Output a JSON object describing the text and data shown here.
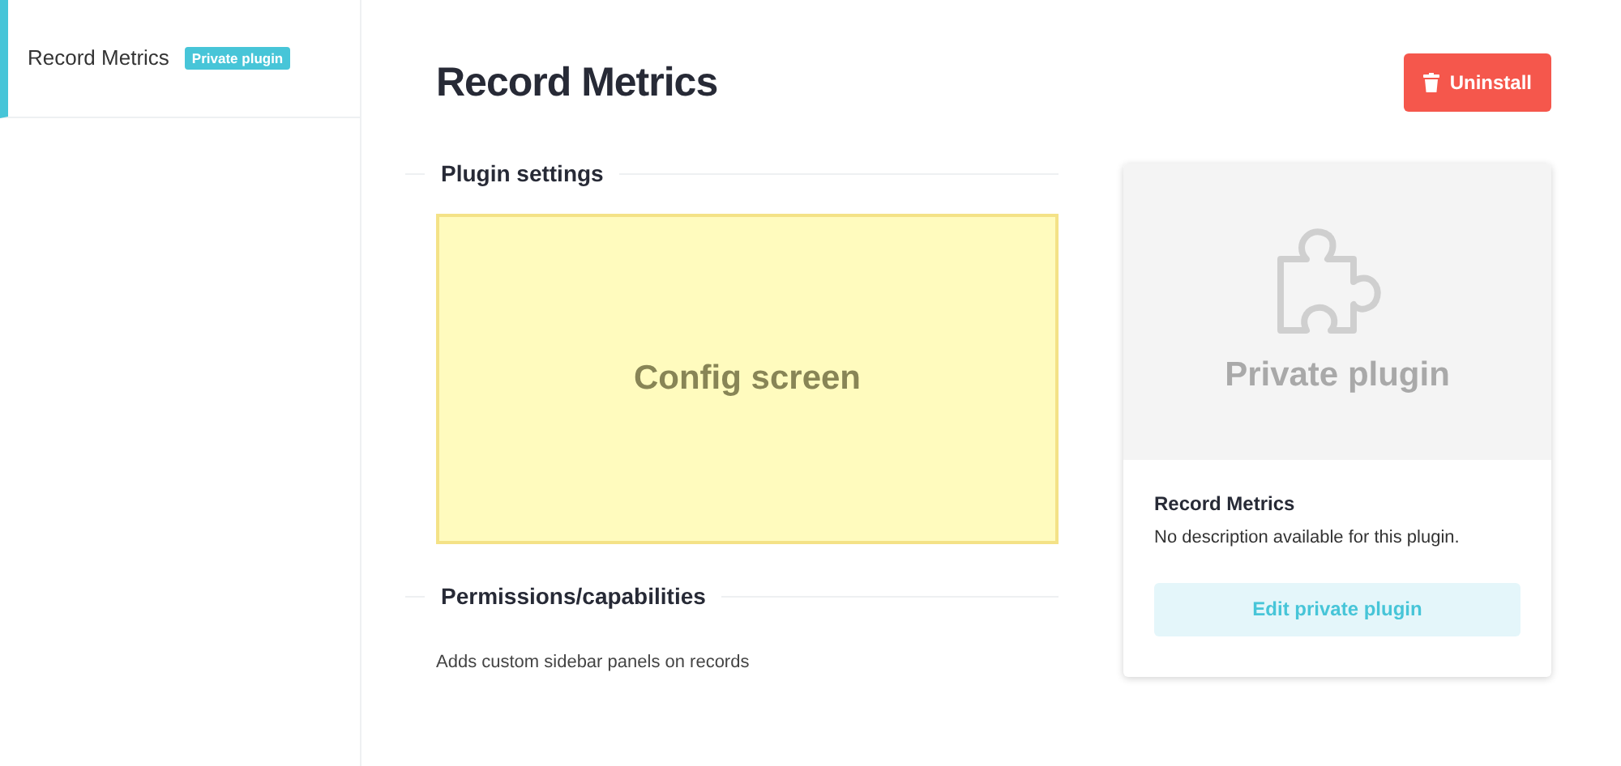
{
  "sidebar": {
    "items": [
      {
        "label": "Record Metrics",
        "badge": "Private plugin",
        "selected": true
      }
    ]
  },
  "header": {
    "title": "Record Metrics",
    "uninstall_button": "Uninstall"
  },
  "sections": [
    {
      "title": "Plugin settings",
      "kind": "config",
      "placeholder_text": "Config screen"
    },
    {
      "title": "Permissions/capabilities",
      "kind": "text",
      "text": "Adds custom sidebar panels on records"
    }
  ],
  "plugin_card": {
    "preview_label": "Private plugin",
    "name": "Record Metrics",
    "description": "No description available for this plugin.",
    "button": "Edit private plugin"
  }
}
